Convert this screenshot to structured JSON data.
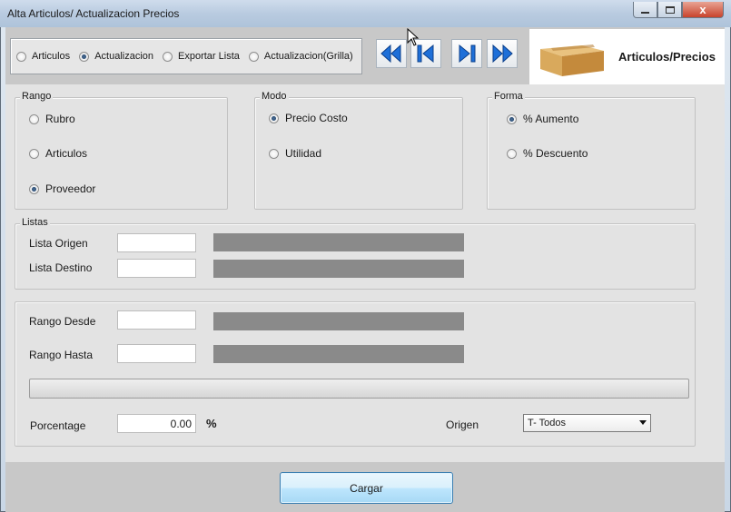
{
  "window": {
    "title": "Alta Articulos/ Actualizacion Precios",
    "min_icon": "minimize-icon",
    "max_icon": "maximize-icon",
    "close_glyph": "x"
  },
  "top_modes": [
    {
      "label": "Articulos",
      "checked": false
    },
    {
      "label": "Actualizacion",
      "checked": true
    },
    {
      "label": "Exportar Lista",
      "checked": false
    },
    {
      "label": "Actualizacion(Grilla)",
      "checked": false
    }
  ],
  "nav": {
    "first_icon": "rewind-double-icon",
    "prev_icon": "skip-back-icon",
    "next_icon": "skip-forward-icon",
    "last_icon": "fast-forward-double-icon",
    "accent": "#1e6fd8"
  },
  "brand": {
    "title": "Articulos/Precios",
    "icon": "cardboard-box-icon"
  },
  "rango": {
    "legend": "Rango",
    "options": [
      {
        "label": "Rubro",
        "checked": false
      },
      {
        "label": "Articulos",
        "checked": false
      },
      {
        "label": "Proveedor",
        "checked": true
      }
    ]
  },
  "modo": {
    "legend": "Modo",
    "options": [
      {
        "label": "Precio Costo",
        "checked": true
      },
      {
        "label": "Utilidad",
        "checked": false
      }
    ]
  },
  "forma": {
    "legend": "Forma",
    "options": [
      {
        "label": "% Aumento",
        "checked": true
      },
      {
        "label": "% Descuento",
        "checked": false
      }
    ]
  },
  "listas": {
    "legend": "Listas",
    "origen_label": "Lista Origen",
    "origen_value": "",
    "destino_label": "Lista Destino",
    "destino_value": ""
  },
  "rangos": {
    "desde_label": "Rango Desde",
    "desde_value": "",
    "hasta_label": "Rango Hasta",
    "hasta_value": ""
  },
  "progress": {
    "value": 0
  },
  "porcentaje": {
    "label": "Porcentage",
    "value": "0.00",
    "unit": "%"
  },
  "origen": {
    "label": "Origen",
    "selected": "T- Todos"
  },
  "footer": {
    "cargar_label": "Cargar"
  }
}
